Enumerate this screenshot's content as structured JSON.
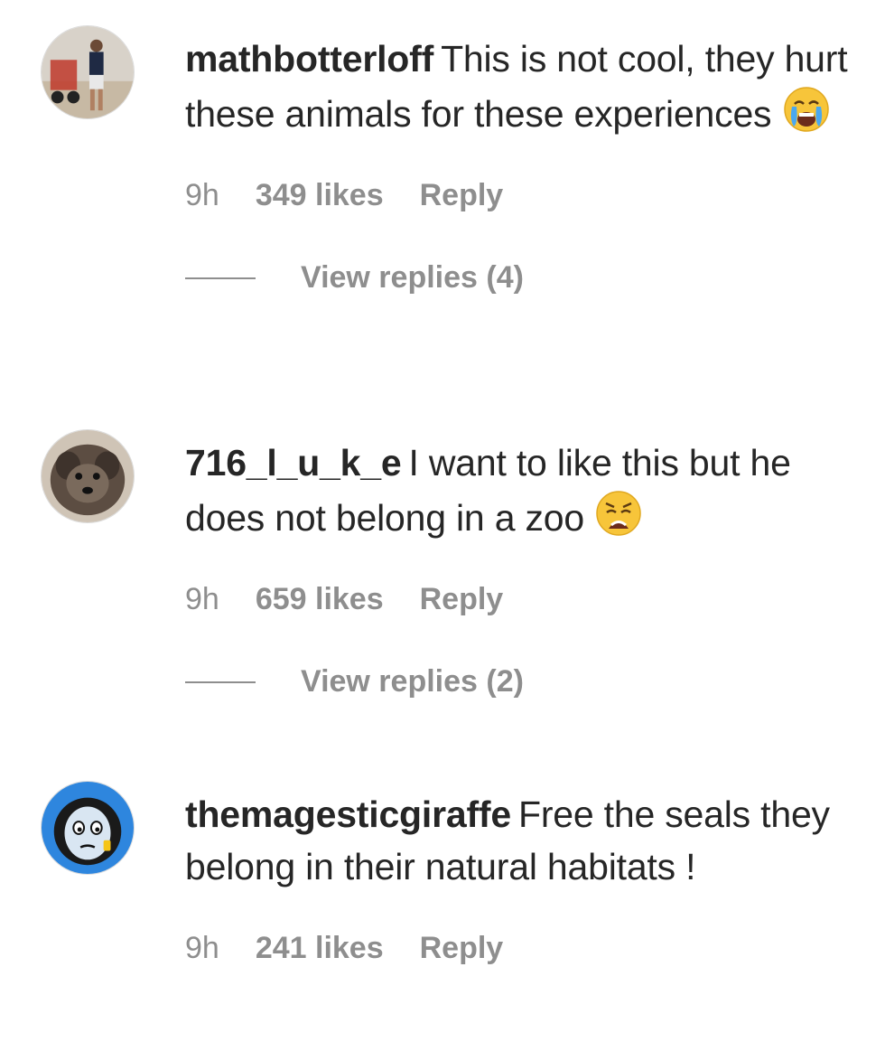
{
  "comments": [
    {
      "username": "mathbotterloff",
      "text": "This is not cool, they hurt these animals for these experiences",
      "emoji": "crying-face-emoji",
      "time": "9h",
      "likes": "349 likes",
      "reply_label": "Reply",
      "view_replies": "View replies (4)"
    },
    {
      "username": "716_l_u_k_e",
      "text": "I want to like this but he does not belong in a zoo",
      "emoji": "weary-face-emoji",
      "time": "9h",
      "likes": "659 likes",
      "reply_label": "Reply",
      "view_replies": "View replies (2)"
    },
    {
      "username": "themagesticgiraffe",
      "text": "Free the seals they belong in their natural habitats !",
      "time": "9h",
      "likes": "241 likes",
      "reply_label": "Reply"
    }
  ]
}
